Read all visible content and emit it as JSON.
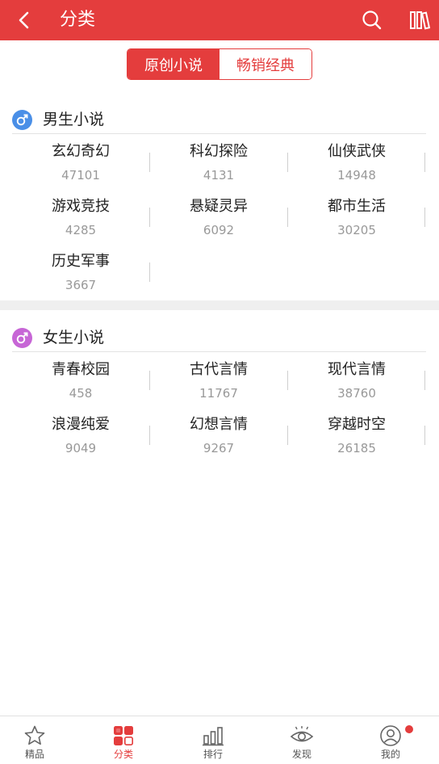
{
  "app": {
    "title": "分类",
    "back_icon": "back-arrow-icon",
    "search_icon": "search-icon",
    "bookshelf_icon": "bookshelf-icon",
    "accent": "#e43d3d"
  },
  "segment": {
    "tabs": [
      {
        "label": "原创小说",
        "active": true
      },
      {
        "label": "畅销经典",
        "active": false
      }
    ]
  },
  "sections": [
    {
      "title": "男生小说",
      "icon": "male-icon",
      "icon_color": "#4a8fe7",
      "items": [
        {
          "name": "玄幻奇幻",
          "count": "47101"
        },
        {
          "name": "科幻探险",
          "count": "4131"
        },
        {
          "name": "仙侠武侠",
          "count": "14948"
        },
        {
          "name": "游戏竞技",
          "count": "4285"
        },
        {
          "name": "悬疑灵异",
          "count": "6092"
        },
        {
          "name": "都市生活",
          "count": "30205"
        },
        {
          "name": "历史军事",
          "count": "3667"
        }
      ]
    },
    {
      "title": "女生小说",
      "icon": "female-icon",
      "icon_color": "#c766d6",
      "items": [
        {
          "name": "青春校园",
          "count": "458"
        },
        {
          "name": "古代言情",
          "count": "11767"
        },
        {
          "name": "现代言情",
          "count": "38760"
        },
        {
          "name": "浪漫纯爱",
          "count": "9049"
        },
        {
          "name": "幻想言情",
          "count": "9267"
        },
        {
          "name": "穿越时空",
          "count": "26185"
        }
      ]
    }
  ],
  "tabbar": {
    "tabs": [
      {
        "label": "精品",
        "icon": "star-icon",
        "active": false
      },
      {
        "label": "分类",
        "icon": "category-icon",
        "active": true
      },
      {
        "label": "排行",
        "icon": "ranking-icon",
        "active": false
      },
      {
        "label": "发现",
        "icon": "eye-icon",
        "active": false
      },
      {
        "label": "我的",
        "icon": "profile-icon",
        "active": false,
        "badge": true
      }
    ]
  }
}
